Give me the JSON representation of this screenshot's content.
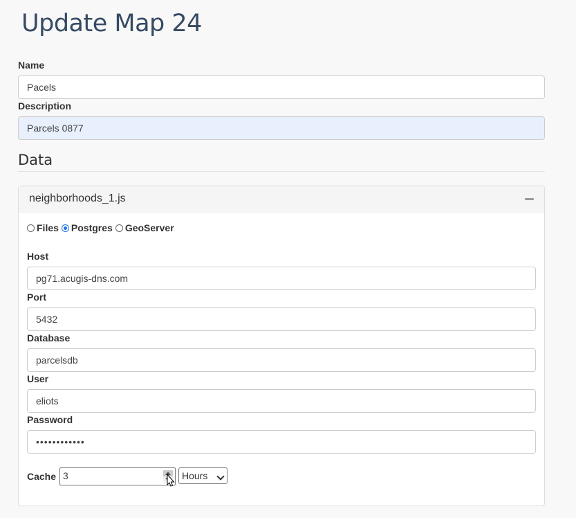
{
  "page": {
    "title": "Update Map 24"
  },
  "form": {
    "name": {
      "label": "Name",
      "value": "Pacels"
    },
    "description": {
      "label": "Description",
      "value": "Parcels 0877"
    }
  },
  "data_section": {
    "title": "Data",
    "panel": {
      "title": "neighborhoods_1.js",
      "collapse_icon": "minus-icon",
      "source_options": [
        {
          "label": "Files",
          "selected": false
        },
        {
          "label": "Postgres",
          "selected": true
        },
        {
          "label": "GeoServer",
          "selected": false
        }
      ],
      "host": {
        "label": "Host",
        "value": "pg71.acugis-dns.com"
      },
      "port": {
        "label": "Port",
        "value": "5432"
      },
      "database": {
        "label": "Database",
        "value": "parcelsdb"
      },
      "user": {
        "label": "User",
        "value": "eliots"
      },
      "password": {
        "label": "Password",
        "value": "••••••••••••"
      },
      "cache": {
        "label": "Cache",
        "value": "3",
        "unit": "Hours"
      }
    }
  },
  "colors": {
    "title": "#364a63",
    "radio_selected": "#1a73e8",
    "autofill": "#e8f0fe"
  }
}
